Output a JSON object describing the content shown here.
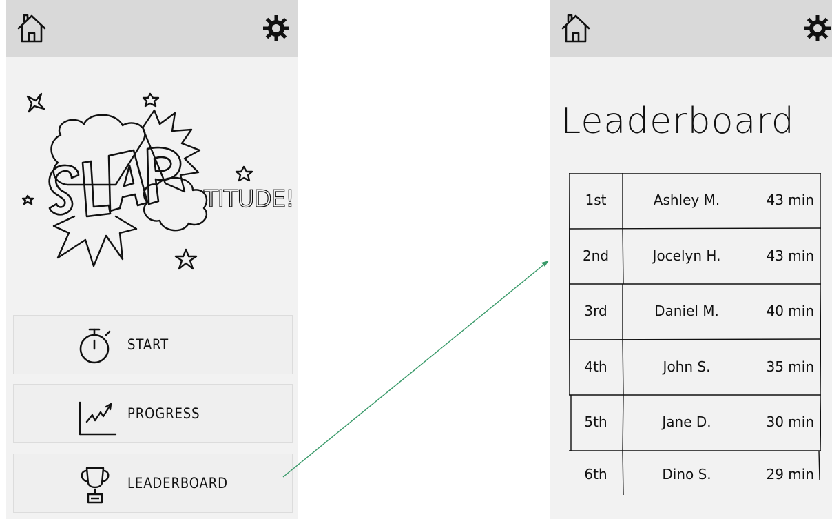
{
  "left_screen": {
    "logo": {
      "text_main": "SLAP",
      "text_suffix": "TITUDE!"
    },
    "menu": [
      {
        "label": "START",
        "icon": "stopwatch-icon"
      },
      {
        "label": "PROGRESS",
        "icon": "trend-chart-icon"
      },
      {
        "label": "LEADERBOARD",
        "icon": "trophy-icon"
      }
    ]
  },
  "right_screen": {
    "title": "Leaderboard",
    "rows": [
      {
        "rank": "1st",
        "name": "Ashley M.",
        "time": "43 min"
      },
      {
        "rank": "2nd",
        "name": "Jocelyn H.",
        "time": "43 min"
      },
      {
        "rank": "3rd",
        "name": "Daniel M.",
        "time": "40 min"
      },
      {
        "rank": "4th",
        "name": "John S.",
        "time": "35 min"
      },
      {
        "rank": "5th",
        "name": "Jane D.",
        "time": "30 min"
      },
      {
        "rank": "6th",
        "name": "Dino S.",
        "time": "29 min"
      }
    ]
  },
  "colors": {
    "topbar": "#d9d9d9",
    "screen_bg": "#f2f2f2",
    "arrow": "#3a9a6a"
  }
}
